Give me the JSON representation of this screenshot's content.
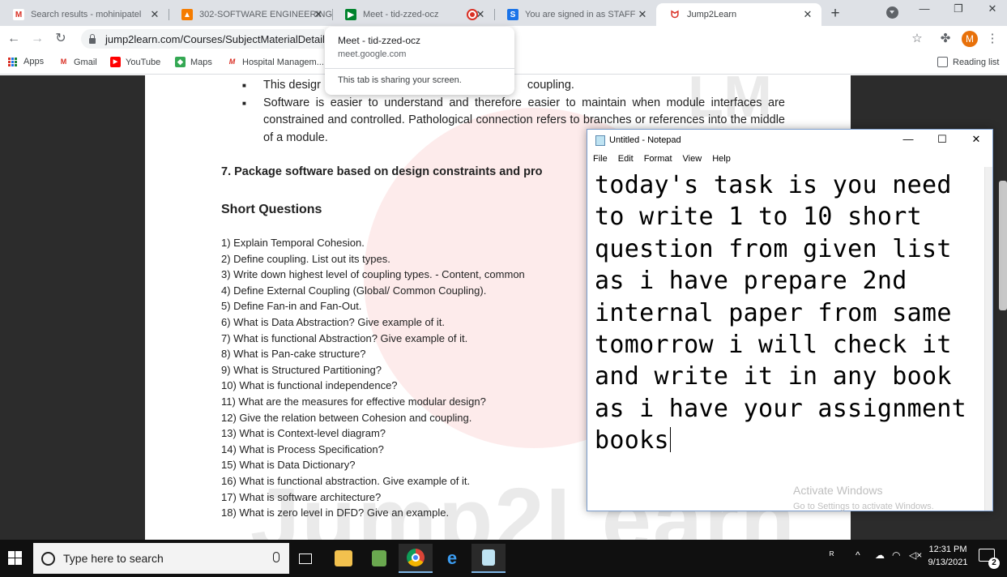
{
  "browser": {
    "tabs": [
      {
        "title": "Search results - mohinipatel",
        "favicon": "gmail-icon",
        "color": "#d93025"
      },
      {
        "title": "302-SOFTWARE ENGINEERING",
        "favicon": "moodle-icon",
        "color": "#f57c00"
      },
      {
        "title": "Meet - tid-zzed-ocz",
        "favicon": "meet-icon",
        "color": "#00832d"
      },
      {
        "title": "",
        "favicon": "recording-icon",
        "color": "#d93025"
      },
      {
        "title": "You are signed in as STAFF",
        "favicon": "s-icon",
        "color": "#1a73e8"
      },
      {
        "title": "Jump2Learn",
        "favicon": "jump2learn-icon",
        "color": "#d93025"
      }
    ],
    "url": "jump2learn.com/Courses/SubjectMaterialDetails",
    "bookmarks": [
      {
        "label": "Apps",
        "icon": "apps-grid-icon"
      },
      {
        "label": "Gmail",
        "icon": "gmail-icon"
      },
      {
        "label": "YouTube",
        "icon": "youtube-icon"
      },
      {
        "label": "Maps",
        "icon": "maps-icon"
      },
      {
        "label": "Hospital Managem...",
        "icon": "hospital-icon"
      }
    ],
    "reading_list": "Reading list",
    "profile_initial": "M"
  },
  "hovercard": {
    "title": "Meet - tid-zzed-ocz",
    "url": "meet.google.com",
    "sharing": "This tab is sharing your screen."
  },
  "document": {
    "bullets": [
      "This design … coupling.",
      "Software is easier to understand and therefore easier to maintain when module interfaces are constrained and controlled. Pathological connection refers to branches or references into the middle of a module."
    ],
    "bullet1_visible_start": "This desigr",
    "bullet1_visible_end": "coupling.",
    "section7": "7.   Package software based on design constraints and pro",
    "short_questions_title": "Short Questions",
    "questions": [
      "1) Explain Temporal Cohesion.",
      "2) Define coupling. List out its types.",
      "3) Write down highest level of coupling types.    -   Content, common",
      "4) Define External Coupling (Global/ Common Coupling).",
      "5) Define Fan-in and Fan-Out.",
      "6) What is Data Abstraction? Give example of it.",
      "7) What is functional Abstraction? Give example of it.",
      "8) What is Pan-cake structure?",
      "9) What is Structured Partitioning?",
      "10) What is functional independence?",
      "11) What are the measures for effective modular design?",
      "12) Give the relation between Cohesion and coupling.",
      "13) What is Context-level diagram?",
      "14) What is Process Specification?",
      "15) What is Data Dictionary?",
      "16) What is functional abstraction. Give example of it.",
      "17) What is software architecture?",
      "18) What is zero level in DFD? Give an example."
    ],
    "watermark": "Jump2Learn",
    "watermark_lm": "LM"
  },
  "notepad": {
    "title": "Untitled - Notepad",
    "menu": [
      "File",
      "Edit",
      "Format",
      "View",
      "Help"
    ],
    "text": "today's task is you need\nto write 1 to 10 short\nquestion from given list\nas i have prepare 2nd\ninternal paper from same\ntomorrow i will check it\nand write it in any book\nas i have your assignment\nbooks",
    "activate_title": "Activate Windows",
    "activate_sub": "Go to Settings to activate Windows."
  },
  "taskbar": {
    "search_placeholder": "Type here to search",
    "time": "12:31 PM",
    "date": "9/13/2021",
    "notification_count": "2"
  }
}
